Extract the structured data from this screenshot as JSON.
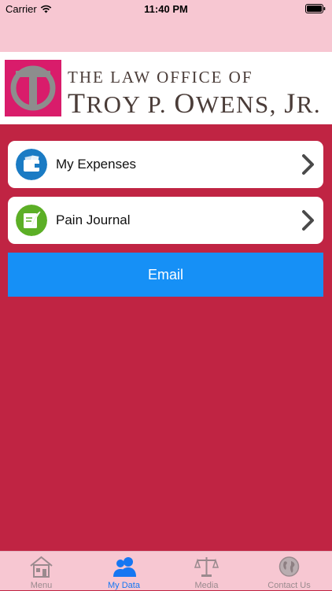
{
  "status_bar": {
    "carrier": "Carrier",
    "time": "11:40 PM"
  },
  "logo": {
    "line1": "THE LAW OFFICE OF",
    "line2": "TROY P. OWENS, JR.",
    "line2_parts": [
      "T",
      "ROY P. ",
      "O",
      "WENS, ",
      "J",
      "R."
    ]
  },
  "menu_items": [
    {
      "label": "My Expenses",
      "icon": "wallet-icon",
      "icon_color": "#1A7BC4"
    },
    {
      "label": "Pain Journal",
      "icon": "journal-icon",
      "icon_color": "#5CAF26"
    }
  ],
  "email_button": {
    "label": "Email"
  },
  "tabs": [
    {
      "label": "Menu",
      "icon": "home-icon",
      "active": false
    },
    {
      "label": "My Data",
      "icon": "users-icon",
      "active": true
    },
    {
      "label": "Media",
      "icon": "scales-icon",
      "active": false
    },
    {
      "label": "Contact Us",
      "icon": "globe-icon",
      "active": false
    }
  ],
  "colors": {
    "background": "#C02443",
    "bars": "#F7C7D2",
    "email": "#1690F6",
    "active_tab": "#1677F2"
  }
}
